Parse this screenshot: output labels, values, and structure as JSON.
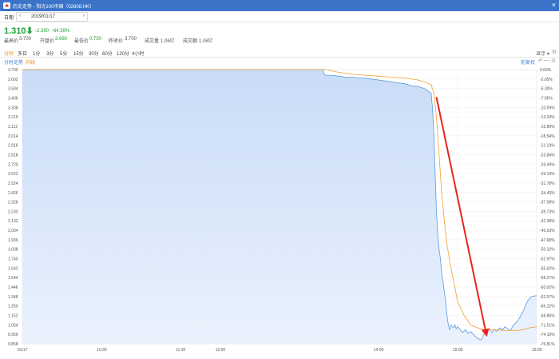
{
  "window": {
    "title": "历史走势 - 阳光100中国（02608.HK）",
    "close_icon": "×"
  },
  "datebar": {
    "label": "日期",
    "date": "2019/01/17"
  },
  "price": {
    "last": "1.310",
    "arrow": "⬇",
    "change": "-2.390",
    "change_pct": "-64.59%"
  },
  "stats": {
    "high_label": "最高价",
    "high": "3.700",
    "open_label": "开盘价",
    "open": "3.660",
    "low_label": "最低价",
    "low": "0.750",
    "prev_label": "昨收价",
    "prev": "3.700",
    "vol_label": "成交量",
    "vol": "1.06亿",
    "amt_label": "成交额",
    "amt": "1.06亿"
  },
  "periods": [
    "分时",
    "多日",
    "1分",
    "3分",
    "5分",
    "15分",
    "30分",
    "60分",
    "120分",
    "4小时"
  ],
  "toolbar": {
    "show_label": "显示 ▾",
    "settings_icon": "⚙"
  },
  "legend": {
    "series1": "分时走势",
    "series2": "均线",
    "adjust": "前复权",
    "undo_icon": "↶",
    "minus_icon": "—",
    "zoom_icon": "⊙"
  },
  "colors": {
    "price_line": "#5a9be0",
    "avg_line": "#f0a030",
    "fill_top": "#c9dcf7",
    "fill_bottom": "#eaf2fd",
    "up_green": "#1d9e39",
    "arrow_red": "#e8241c"
  },
  "chart_data": {
    "type": "area",
    "y_left_ticks": [
      "3.700",
      "3.602",
      "3.504",
      "3.406",
      "3.308",
      "3.210",
      "3.112",
      "3.014",
      "2.916",
      "2.818",
      "2.720",
      "2.622",
      "2.524",
      "2.426",
      "2.328",
      "2.230",
      "2.132",
      "2.034",
      "1.936",
      "1.838",
      "1.740",
      "1.642",
      "1.544",
      "1.446",
      "1.348",
      "1.250",
      "1.152",
      "1.054",
      "0.956",
      "0.858"
    ],
    "y_right_ticks": [
      "0.00%",
      "-2.65%",
      "-5.30%",
      "-7.95%",
      "-10.59%",
      "-13.24%",
      "-15.89%",
      "-18.54%",
      "-21.19%",
      "-23.84%",
      "-26.49%",
      "-29.14%",
      "-31.78%",
      "-34.43%",
      "-37.08%",
      "-39.73%",
      "-42.38%",
      "-45.03%",
      "-47.68%",
      "-50.32%",
      "-52.97%",
      "-55.62%",
      "-58.27%",
      "-60.92%",
      "-63.57%",
      "-66.22%",
      "-68.86%",
      "-71.51%",
      "-74.16%",
      "-76.81%"
    ],
    "x_ticks": [
      {
        "label": "01/17",
        "t": 0
      },
      {
        "label": "10:30",
        "t": 60
      },
      {
        "label": "11:30",
        "t": 120
      },
      {
        "label": "12:00",
        "t": 150
      },
      {
        "label": "14:00",
        "t": 270
      },
      {
        "label": "15:00",
        "t": 330
      },
      {
        "label": "16:00",
        "t": 390
      }
    ],
    "ylim": [
      0.8,
      3.7
    ],
    "xlim": [
      0,
      390
    ],
    "series": [
      {
        "name": "分时走势",
        "t": [
          0,
          150,
          228,
          229,
          230,
          235,
          240,
          245,
          250,
          255,
          260,
          265,
          270,
          275,
          280,
          285,
          290,
          295,
          300,
          305,
          310,
          311,
          312,
          313,
          314,
          315,
          316,
          317,
          318,
          319,
          320,
          321,
          322,
          323,
          324,
          325,
          326,
          327,
          328,
          329,
          330,
          332,
          334,
          336,
          338,
          340,
          342,
          345,
          348,
          350,
          352,
          354,
          356,
          358,
          360,
          362,
          364,
          366,
          368,
          370,
          372,
          374,
          376,
          378,
          380,
          383,
          386,
          390
        ],
        "values": [
          3.7,
          3.7,
          3.7,
          3.65,
          3.64,
          3.64,
          3.63,
          3.62,
          3.62,
          3.61,
          3.61,
          3.6,
          3.59,
          3.58,
          3.57,
          3.56,
          3.55,
          3.53,
          3.52,
          3.5,
          3.45,
          3.3,
          3.05,
          2.6,
          2.2,
          1.95,
          1.8,
          1.7,
          1.55,
          1.45,
          1.35,
          1.25,
          1.1,
          1.0,
          0.95,
          1.0,
          0.98,
          0.97,
          1.0,
          0.96,
          0.98,
          0.95,
          0.92,
          0.95,
          0.91,
          0.93,
          0.9,
          0.86,
          0.84,
          0.9,
          0.93,
          0.96,
          0.92,
          0.95,
          0.93,
          0.97,
          0.95,
          0.98,
          0.96,
          0.94,
          0.99,
          1.02,
          1.05,
          1.1,
          1.15,
          1.25,
          1.3,
          1.31
        ]
      },
      {
        "name": "均线",
        "t": [
          0,
          230,
          240,
          250,
          260,
          270,
          280,
          290,
          300,
          305,
          310,
          312,
          314,
          316,
          318,
          320,
          322,
          325,
          328,
          330,
          335,
          340,
          345,
          350,
          355,
          360,
          365,
          370,
          375,
          380,
          385,
          390
        ],
        "values": [
          3.7,
          3.7,
          3.67,
          3.65,
          3.64,
          3.63,
          3.62,
          3.61,
          3.59,
          3.57,
          3.54,
          3.45,
          3.2,
          2.8,
          2.4,
          2.1,
          1.85,
          1.6,
          1.4,
          1.25,
          1.1,
          1.0,
          0.97,
          0.95,
          0.95,
          0.95,
          0.94,
          0.94,
          0.94,
          0.95,
          0.97,
          0.98
        ]
      }
    ],
    "annotation": {
      "type": "arrow",
      "color": "#e8241c",
      "from": {
        "t": 314,
        "v": 3.41
      },
      "to": {
        "t": 352,
        "v": 0.89
      }
    },
    "grid": true
  }
}
